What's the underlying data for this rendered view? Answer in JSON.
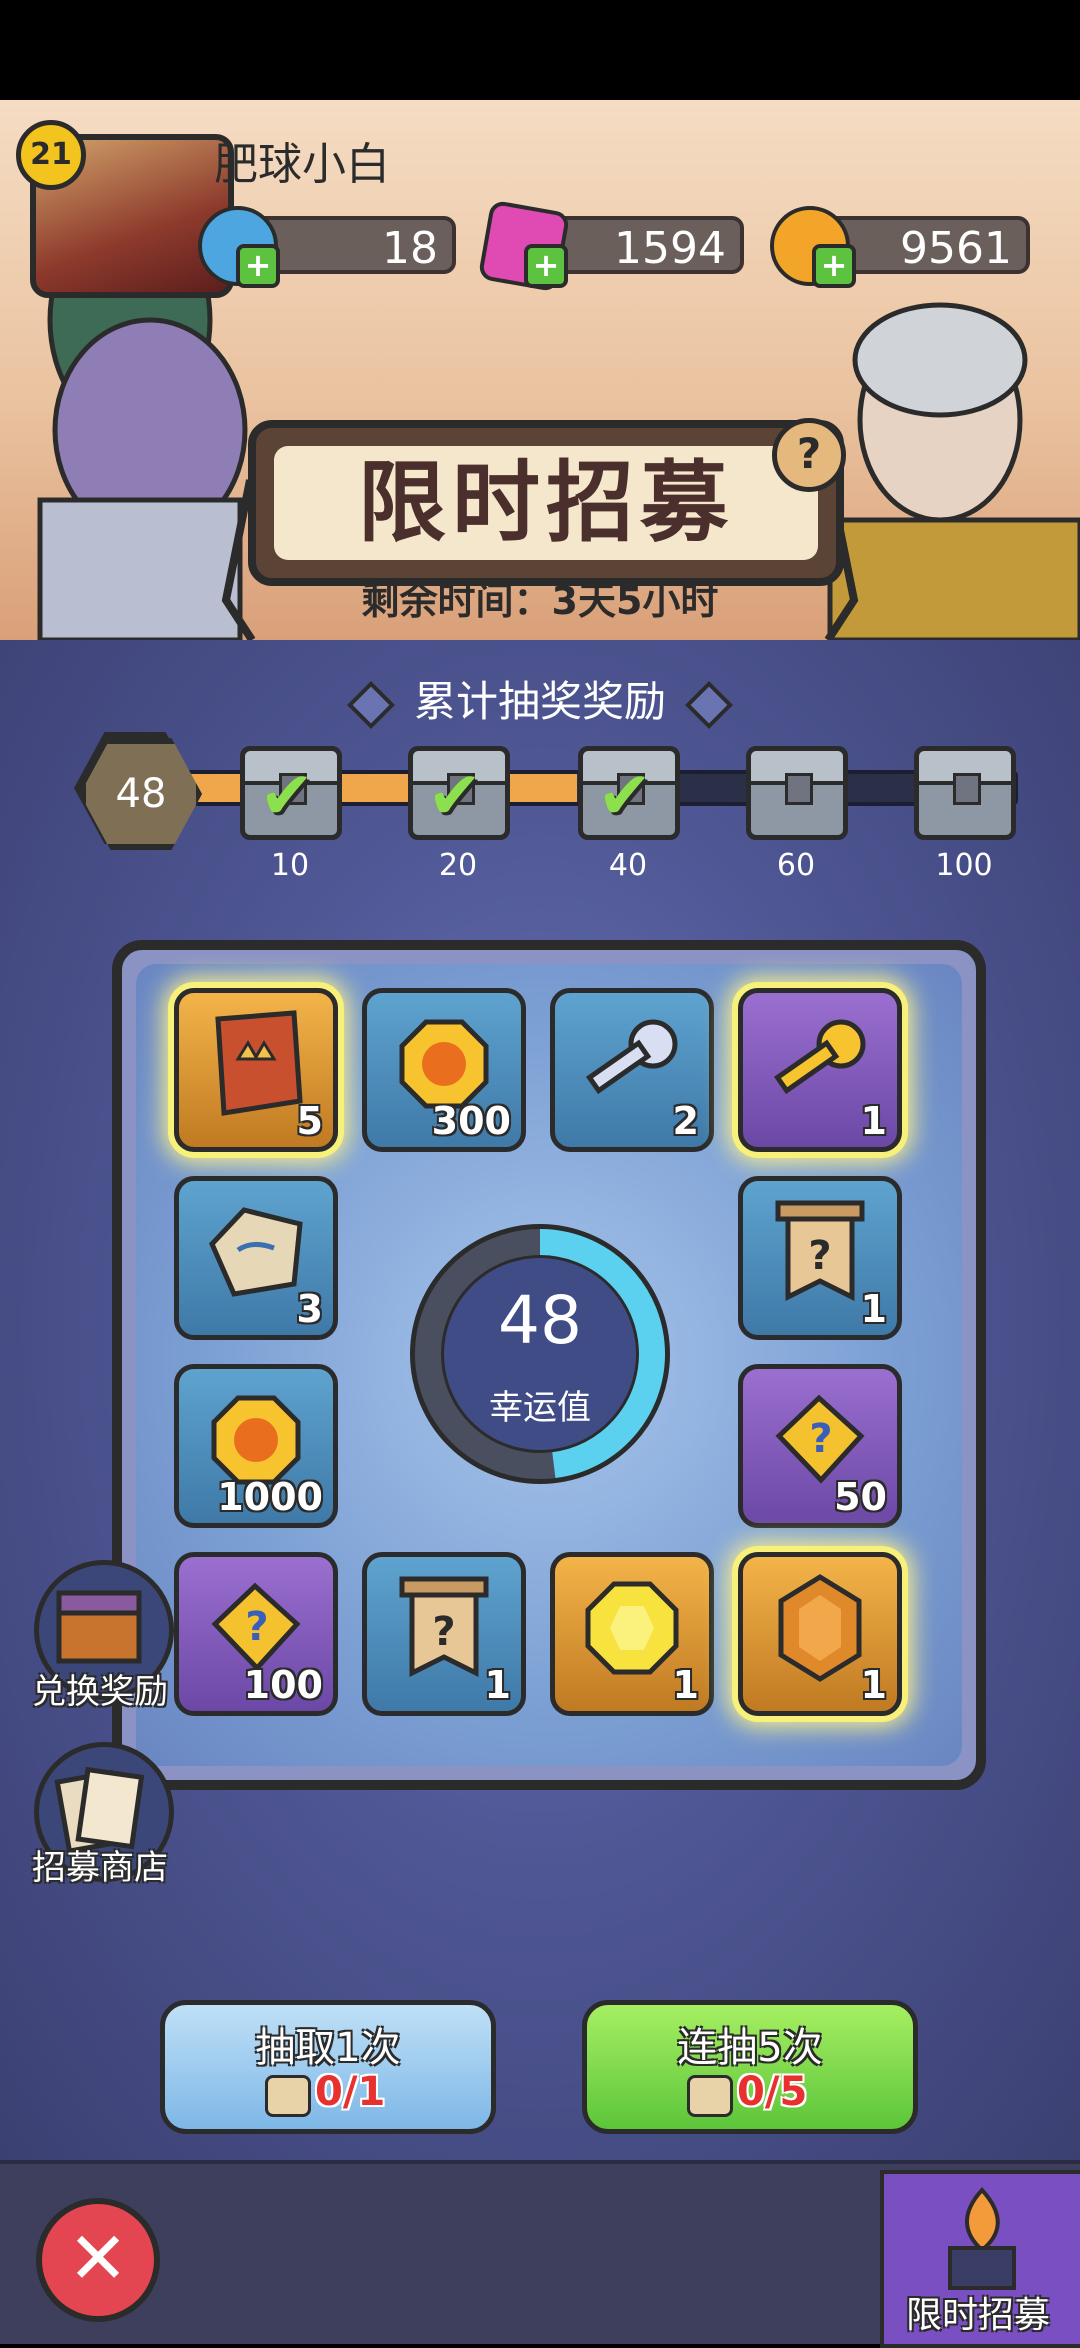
{
  "player": {
    "level": "21",
    "name": "肥球小白"
  },
  "resources": [
    {
      "icon": "blue-gem-coin-icon",
      "value": "18",
      "color": "#4ea6e0"
    },
    {
      "icon": "pink-crystal-icon",
      "value": "1594",
      "color": "#e04bb3"
    },
    {
      "icon": "gold-coin-icon",
      "value": "9561",
      "color": "#f3a52a"
    }
  ],
  "event": {
    "title": "限时招募",
    "help": "?",
    "remaining": "剩余时间：3天5小时"
  },
  "milestones": {
    "title": "累计抽奖奖励",
    "current": "48",
    "progress_fraction": 0.48,
    "items": [
      {
        "label": "10",
        "claimed": true
      },
      {
        "label": "20",
        "claimed": true
      },
      {
        "label": "40",
        "claimed": true
      },
      {
        "label": "60",
        "claimed": false
      },
      {
        "label": "100",
        "claimed": false
      }
    ]
  },
  "board": {
    "luck_value": "48",
    "luck_label": "幸运值",
    "luck_fraction": 0.48,
    "tiles": [
      {
        "name": "hero-card-icon",
        "qty": "5",
        "style": "gold",
        "glow": true
      },
      {
        "name": "gold-coin-icon",
        "qty": "300",
        "style": "blue",
        "glow": false
      },
      {
        "name": "silver-key-icon",
        "qty": "2",
        "style": "blue",
        "glow": false
      },
      {
        "name": "gold-key-icon",
        "qty": "1",
        "style": "purple",
        "glow": true
      },
      {
        "name": "rune-stone-icon",
        "qty": "3",
        "style": "blue",
        "glow": false
      },
      {
        "name": "mystery-banner-icon",
        "qty": "1",
        "style": "blue",
        "glow": false
      },
      {
        "name": "gold-coin-icon",
        "qty": "1000",
        "style": "blue",
        "glow": false
      },
      {
        "name": "puzzle-piece-icon",
        "qty": "50",
        "style": "purple",
        "glow": false
      },
      {
        "name": "puzzle-piece-icon",
        "qty": "100",
        "style": "purple",
        "glow": false
      },
      {
        "name": "mystery-banner-icon",
        "qty": "1",
        "style": "blue",
        "glow": false
      },
      {
        "name": "yellow-gem-icon",
        "qty": "1",
        "style": "gold",
        "glow": false
      },
      {
        "name": "orange-gem-icon",
        "qty": "1",
        "style": "gold",
        "glow": true
      }
    ]
  },
  "side": {
    "exchange": "兑换奖励",
    "shop": "招募商店"
  },
  "draw": {
    "single": {
      "label": "抽取1次",
      "cost": "0/1"
    },
    "multi": {
      "label": "连抽5次",
      "cost": "0/5"
    }
  },
  "bottom": {
    "close": "✕",
    "tab": "限时招募"
  }
}
